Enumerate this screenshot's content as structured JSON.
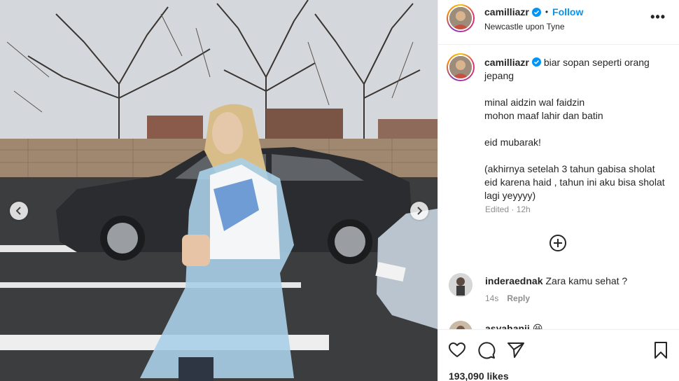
{
  "post": {
    "username": "camilliazr",
    "follow_label": "Follow",
    "separator": "•",
    "location": "Newcastle upon Tyne",
    "more_label": "•••"
  },
  "caption": {
    "username": "camilliazr",
    "line1": "biar sopan seperti orang jepang",
    "line2": "minal aidzin wal faidzin",
    "line3": "mohon maaf lahir dan batin",
    "line4": "eid mubarak!",
    "line5": "(akhirnya setelah 3 tahun gabisa sholat eid karena haid , tahun ini aku bisa sholat lagi yeyyyy)",
    "edited": "Edited · 12h"
  },
  "comments": [
    {
      "username": "inderaednak",
      "text": "Zara kamu sehat ?",
      "time": "14s",
      "reply_label": "Reply"
    },
    {
      "username": "asyahanii",
      "text": "😆"
    }
  ],
  "likes": "193,090 likes",
  "icons": {
    "verified": "verified-badge-icon",
    "prev": "chevron-left-icon",
    "next": "chevron-right-icon",
    "load_more": "plus-circle-icon",
    "like": "heart-icon",
    "comment": "comment-bubble-icon",
    "share": "paper-plane-icon",
    "save": "bookmark-icon"
  },
  "colors": {
    "accent": "#0095f6",
    "text": "#262626",
    "muted": "#8e8e8e",
    "border": "#efefef"
  }
}
